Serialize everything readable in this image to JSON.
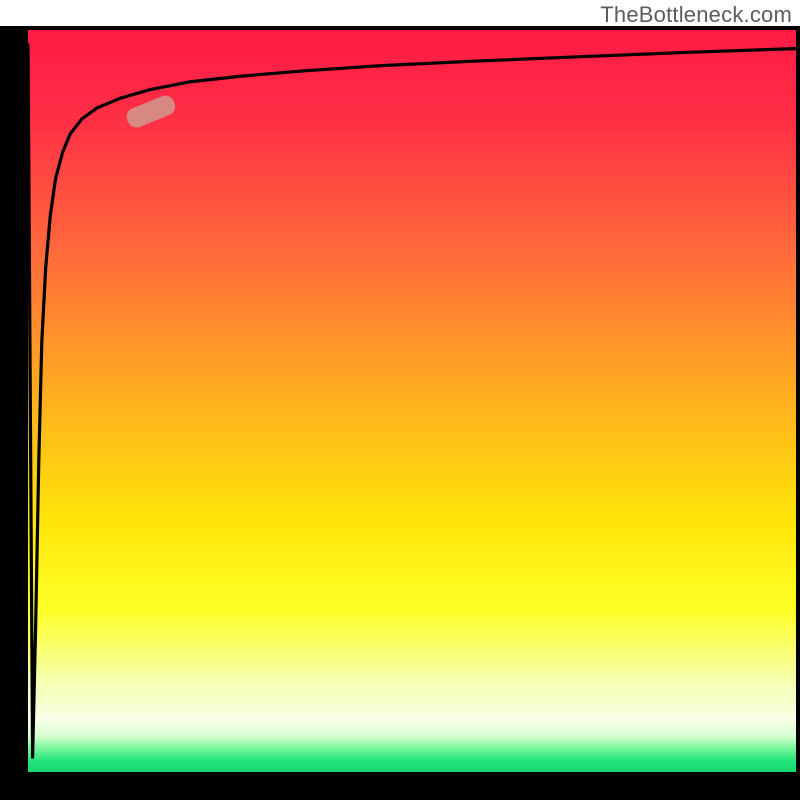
{
  "watermark": "TheBottleneck.com",
  "colors": {
    "frame_black": "#000000",
    "curve_black": "#000000",
    "marker_fill": "#d59088",
    "gradient_stops": [
      {
        "offset": 0.0,
        "color": "#ff1a45"
      },
      {
        "offset": 0.12,
        "color": "#ff2f46"
      },
      {
        "offset": 0.3,
        "color": "#ff6a3b"
      },
      {
        "offset": 0.5,
        "color": "#ffb11e"
      },
      {
        "offset": 0.66,
        "color": "#ffe409"
      },
      {
        "offset": 0.78,
        "color": "#fdff25"
      },
      {
        "offset": 0.88,
        "color": "#f6ffb3"
      },
      {
        "offset": 0.93,
        "color": "#f8ffe8"
      },
      {
        "offset": 0.952,
        "color": "#d6ffd1"
      },
      {
        "offset": 0.965,
        "color": "#89f8a4"
      },
      {
        "offset": 0.985,
        "color": "#23e47a"
      },
      {
        "offset": 1.0,
        "color": "#19d76f"
      }
    ]
  },
  "chart_data": {
    "type": "line",
    "title": "",
    "xlabel": "",
    "ylabel": "",
    "xlim": [
      0,
      100
    ],
    "ylim": [
      0,
      100
    ],
    "series": [
      {
        "name": "bottleneck-curve",
        "x": [
          0.0,
          0.6,
          1.0,
          1.4,
          1.8,
          2.3,
          2.9,
          3.6,
          4.5,
          5.5,
          7.0,
          9.0,
          12.0,
          16.0,
          21.0,
          28.0,
          36.0,
          46.0,
          58.0,
          72.0,
          86.0,
          100.0
        ],
        "y": [
          98.0,
          2.0,
          20.0,
          42.0,
          58.0,
          68.0,
          75.0,
          80.0,
          83.5,
          86.0,
          88.0,
          89.5,
          90.8,
          92.0,
          93.0,
          93.8,
          94.5,
          95.2,
          95.8,
          96.4,
          97.0,
          97.5
        ]
      }
    ],
    "highlight_marker": {
      "series": "bottleneck-curve",
      "x": 16.0,
      "y": 89.0,
      "angle_deg": 22
    },
    "frame": {
      "left_thickness_px": 28,
      "bottom_thickness_px": 28,
      "top_thickness_px": 4,
      "right_thickness_px": 4
    },
    "notes": "No axis tick labels are visible; ranges are normalized 0–100. The curve is a steep bottleneck-style curve with a sharp spike down at x≈0.6. A pale oblong marker sits on the curve around (16, 89)."
  }
}
